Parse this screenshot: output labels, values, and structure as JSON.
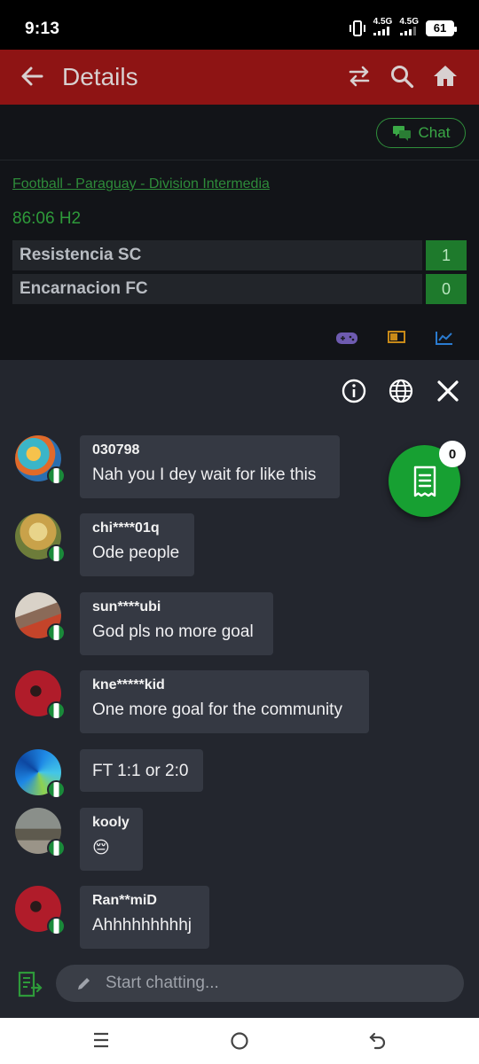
{
  "status_bar": {
    "time": "9:13",
    "net1": "4.5G",
    "net2": "4.5G",
    "battery": "61"
  },
  "app_bar": {
    "title": "Details"
  },
  "match": {
    "chat_label": "Chat",
    "league": "Football - Paraguay - Division Intermedia",
    "clock": "86:06 H2",
    "teams": [
      {
        "name": "Resistencia SC",
        "score": "1"
      },
      {
        "name": "Encarnacion FC",
        "score": "0"
      }
    ]
  },
  "messages": [
    {
      "user": "030798",
      "text": "Nah you I dey wait for like this"
    },
    {
      "user": "chi****01q",
      "text": "Ode people"
    },
    {
      "user": "sun****ubi",
      "text": "God pls no more goal"
    },
    {
      "user": "kne*****kid",
      "text": "One more goal for the community"
    },
    {
      "user": "",
      "text": "FT 1:1 or 2:0"
    },
    {
      "user": "kooly",
      "text": "😔"
    },
    {
      "user": "Ran**miD",
      "text": "Ahhhhhhhhhj"
    }
  ],
  "bet_slip": {
    "count": "0"
  },
  "composer": {
    "placeholder": "Start chatting..."
  },
  "colors": {
    "appbar": "#8e1414",
    "accent_green": "#2e9a3a",
    "panel": "#23262e",
    "bubble": "#353943"
  }
}
